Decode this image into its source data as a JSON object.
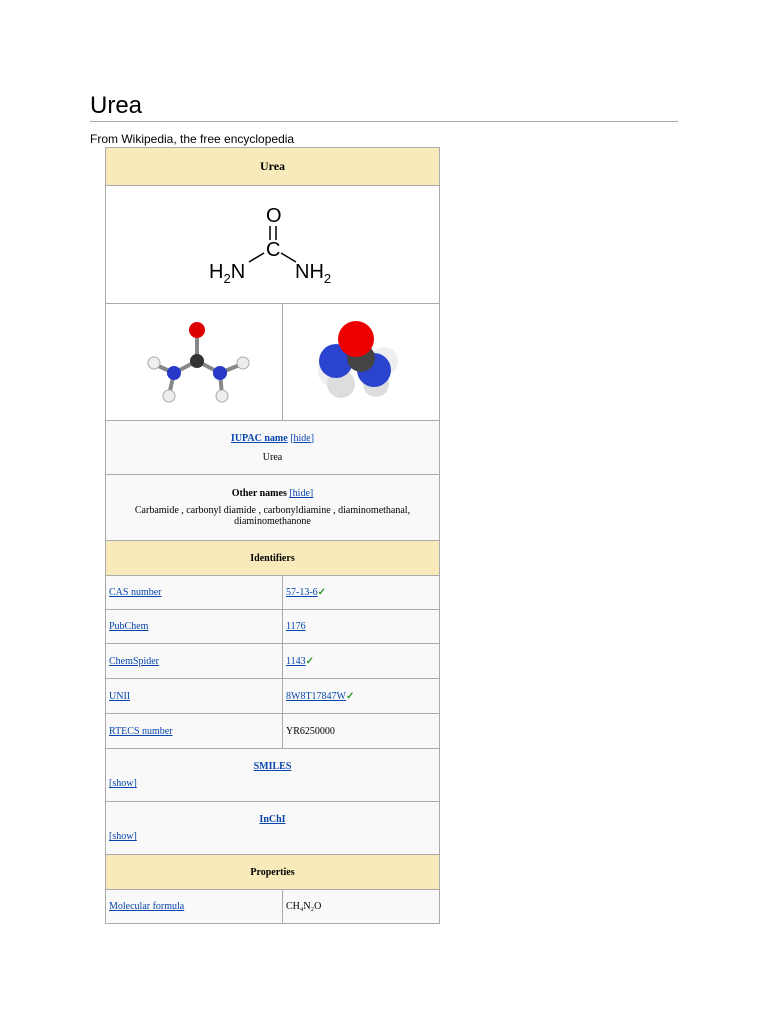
{
  "page": {
    "title": "Urea",
    "subtitle": "From Wikipedia, the free encyclopedia"
  },
  "infobox": {
    "title": "Urea",
    "structure_labels": {
      "o": "O",
      "c": "C",
      "h2n": "H",
      "n1": "N",
      "nh": "NH",
      "sub": "2"
    },
    "iupac_label": "IUPAC name",
    "hide1": "[hide]",
    "iupac_value": "Urea",
    "other_label": "Other names",
    "hide2": "[hide]",
    "other_value": "Carbamide , carbonyl diamide , carbonyldiamine , diaminomethanal, diaminomethanone",
    "identifiers_header": "Identifiers",
    "identifiers": [
      {
        "label": "CAS number",
        "value": "57-13-6",
        "check": "✓"
      },
      {
        "label": "PubChem",
        "value": "1176",
        "check": ""
      },
      {
        "label": "ChemSpider",
        "value": "1143",
        "check": "✓"
      },
      {
        "label": "UNII",
        "value": "8W8T17847W",
        "check": "✓"
      },
      {
        "label": "RTECS number",
        "value": "YR6250000",
        "check": ""
      }
    ],
    "smiles_label": "SMILES",
    "smiles_show": "[show]",
    "inchi_label": "InChI",
    "inchi_show": "[show]",
    "properties_header": "Properties",
    "formula_label": "Molecular formula",
    "formula_value": "CH₄N₂O",
    "colors": {
      "header": "#f8eaba",
      "link": "#0645ad",
      "oxygen": "#e00000",
      "nitrogen": "#2040d0",
      "carbon": "#404040"
    }
  }
}
